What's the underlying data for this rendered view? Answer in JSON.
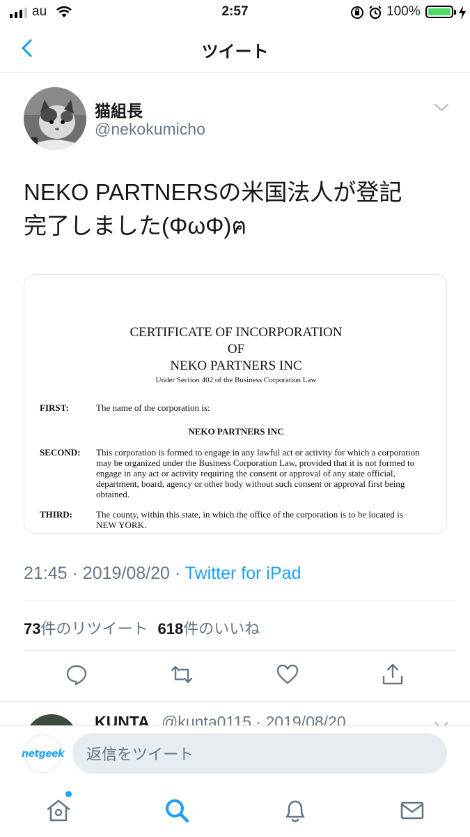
{
  "status_bar": {
    "carrier": "au",
    "time": "2:57",
    "battery": "100%"
  },
  "nav": {
    "title": "ツイート",
    "back_icon": "chevron-left-icon"
  },
  "tweet": {
    "display_name": "猫組長",
    "handle": "@nekokumicho",
    "text_line1": "NEKO PARTNERSの米国法人が登記",
    "text_line2": "完了しました(ΦωΦ)ฅ",
    "time": "21:45",
    "date": "2019/08/20",
    "separator": "·",
    "source": "Twitter for iPad",
    "retweet_count": "73",
    "retweet_label": "件のリツイート",
    "like_count": "618",
    "like_label": "件のいいね"
  },
  "document": {
    "title_line1": "CERTIFICATE OF INCORPORATION",
    "title_line2": "OF",
    "title_line3": "NEKO PARTNERS INC",
    "subtitle": "Under Section 402 of the Business Corporation Law",
    "first_label": "FIRST:",
    "first_text": "The name of the corporation is:",
    "corp_name": "NEKO PARTNERS INC",
    "second_label": "SECOND:",
    "second_line1": "This corporation is formed to engage in any lawful act or activity for which a corporation",
    "second_line2": "may be organized under the Business Corporation Law, provided that it is not formed to",
    "second_line3": "engage in any act or activity requiring the consent or approval of any state official,",
    "second_line4": "department, board, agency or other body without such consent or approval first being",
    "second_line5": "obtained.",
    "third_label": "THIRD:",
    "third_line1": "The county, within this state, in which the office of the corporation is to be located is",
    "third_line2": "NEW YORK."
  },
  "peek_reply": {
    "name": "KUNTA",
    "meta": "@kunta0115 · 2019/08/20"
  },
  "reply_bar": {
    "avatar_text": "netgeek",
    "placeholder": "返信をツイート"
  },
  "icons": {
    "reply": "reply-icon",
    "retweet": "retweet-icon",
    "like": "heart-icon",
    "share": "share-icon",
    "home": "home-icon",
    "search": "search-icon",
    "notifications": "bell-icon",
    "messages": "mail-icon"
  },
  "colors": {
    "accent": "#1da1f2",
    "secondary_text": "#657786",
    "battery": "#4cd964"
  }
}
